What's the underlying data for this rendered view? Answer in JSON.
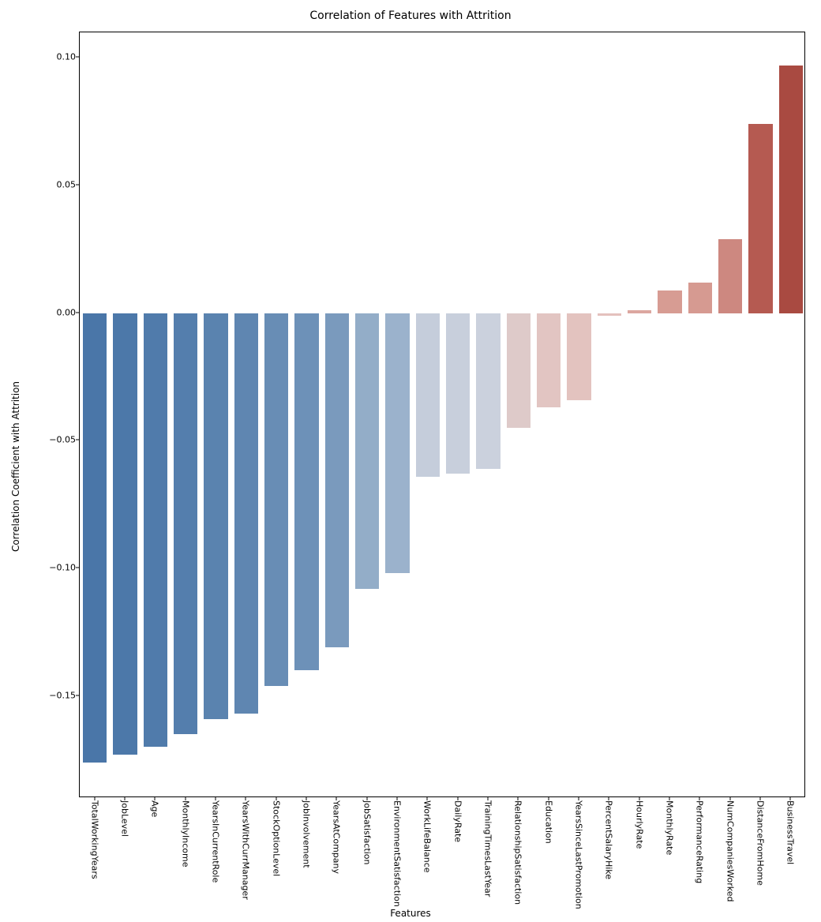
{
  "chart_data": {
    "type": "bar",
    "title": "Correlation of Features with Attrition",
    "xlabel": "Features",
    "ylabel": "Correlation Coefficient with Attrition",
    "ylim": [
      -0.19,
      0.11
    ],
    "yticks": [
      -0.15,
      -0.1,
      -0.05,
      0.0,
      0.05,
      0.1
    ],
    "ytick_labels": [
      "−0.15",
      "−0.10",
      "−0.05",
      "0.00",
      "0.05",
      "0.10"
    ],
    "categories": [
      "TotalWorkingYears",
      "JobLevel",
      "Age",
      "MonthlyIncome",
      "YearsInCurrentRole",
      "YearsWithCurrManager",
      "StockOptionLevel",
      "JobInvolvement",
      "YearsAtCompany",
      "JobSatisfaction",
      "EnvironmentSatisfaction",
      "WorkLifeBalance",
      "DailyRate",
      "TrainingTimesLastYear",
      "RelationshipSatisfaction",
      "Education",
      "YearsSinceLastPromotion",
      "PercentSalaryHike",
      "HourlyRate",
      "MonthlyRate",
      "PerformanceRating",
      "NumCompaniesWorked",
      "DistanceFromHome",
      "BusinessTravel"
    ],
    "values": [
      -0.176,
      -0.173,
      -0.17,
      -0.165,
      -0.159,
      -0.157,
      -0.146,
      -0.14,
      -0.131,
      -0.108,
      -0.102,
      -0.064,
      -0.063,
      -0.061,
      -0.045,
      -0.037,
      -0.034,
      -0.001,
      0.001,
      0.009,
      0.012,
      0.029,
      0.074,
      0.097
    ],
    "colors": [
      "#4a76a8",
      "#4c78a9",
      "#507bab",
      "#547ead",
      "#5a83af",
      "#5f86b1",
      "#688db5",
      "#6d91b8",
      "#7a9abd",
      "#93adc8",
      "#9bb2cc",
      "#c5cddb",
      "#c8cfdc",
      "#cbd1dd",
      "#decac9",
      "#e2c5c2",
      "#e3c3bf",
      "#e4c1bd",
      "#dca7a0",
      "#d79c93",
      "#d69a91",
      "#cd8880",
      "#b55a51",
      "#a94a41"
    ]
  }
}
